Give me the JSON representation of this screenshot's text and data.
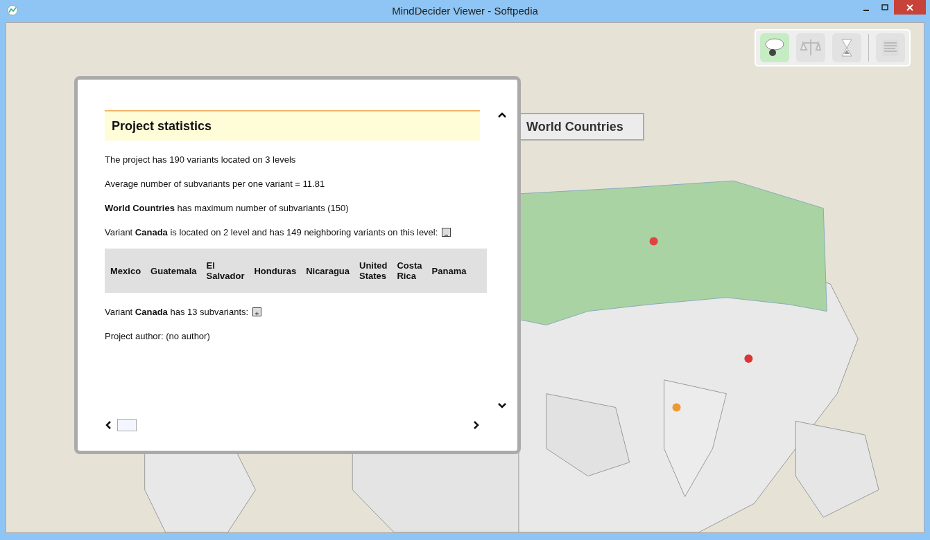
{
  "window": {
    "title": "MindDecider Viewer - Softpedia"
  },
  "toolbar": {
    "buttons": [
      {
        "kind": "ideas",
        "selected": true
      },
      {
        "kind": "scales",
        "selected": false
      },
      {
        "kind": "hourglass",
        "selected": false
      },
      {
        "kind": "document",
        "selected": false
      }
    ]
  },
  "node": {
    "label": "World Countries"
  },
  "statistics": {
    "title": "Project statistics",
    "paragraphs": [
      {
        "text": "The project has 190 variants located on 3 levels"
      },
      {
        "text": "Average number of subvariants per one variant = 11.81"
      },
      {
        "text": "**World Countries** has maximum number of subvariants (150)"
      },
      {
        "text": "Variant **Canada** is located on 2 level and has 149 neighboring variants on this level:",
        "toggle": {
          "expanded": true
        },
        "neighbors": [
          "Mexico",
          "Guatemala",
          "El Salvador",
          "Honduras",
          "Nicaragua",
          "United States",
          "Costa Rica",
          "Panama"
        ]
      },
      {
        "text": "Variant **Canada** has 13 subvariants:",
        "toggle": {
          "expanded": false
        }
      },
      {
        "text": "Project author: (no author)"
      }
    ]
  }
}
